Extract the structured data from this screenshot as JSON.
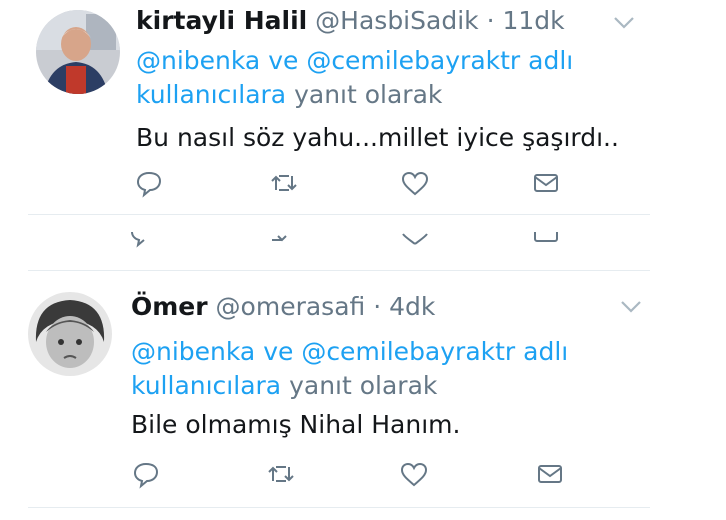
{
  "tweets": [
    {
      "name": "kirtayli Halil",
      "handle": "@HasbiSadik",
      "dot": "·",
      "time": "11dk",
      "reply_mentions": "@nibenka ve @cemilebayraktr adlı kullanıcılara",
      "reply_suffix": "yanıt olarak",
      "text": "Bu nasıl söz yahu...millet iyice şaşırdı..",
      "avatar_icon": "user-avatar-icon"
    },
    {
      "name": "Ömer",
      "handle": "@omerasafi",
      "dot": "·",
      "time": "4dk",
      "reply_mentions": "@nibenka ve @cemilebayraktr adlı kullanıcılara",
      "reply_suffix": "yanıt olarak",
      "text": "Bile olmamış Nihal Hanım.",
      "avatar_icon": "user-avatar-icon"
    }
  ],
  "colors": {
    "link": "#1da1f2",
    "muted": "#657786",
    "text": "#14171a",
    "divider": "#e6ecf0"
  },
  "icons": [
    "reply-icon",
    "retweet-icon",
    "like-icon",
    "message-icon",
    "chevron-down-icon"
  ]
}
